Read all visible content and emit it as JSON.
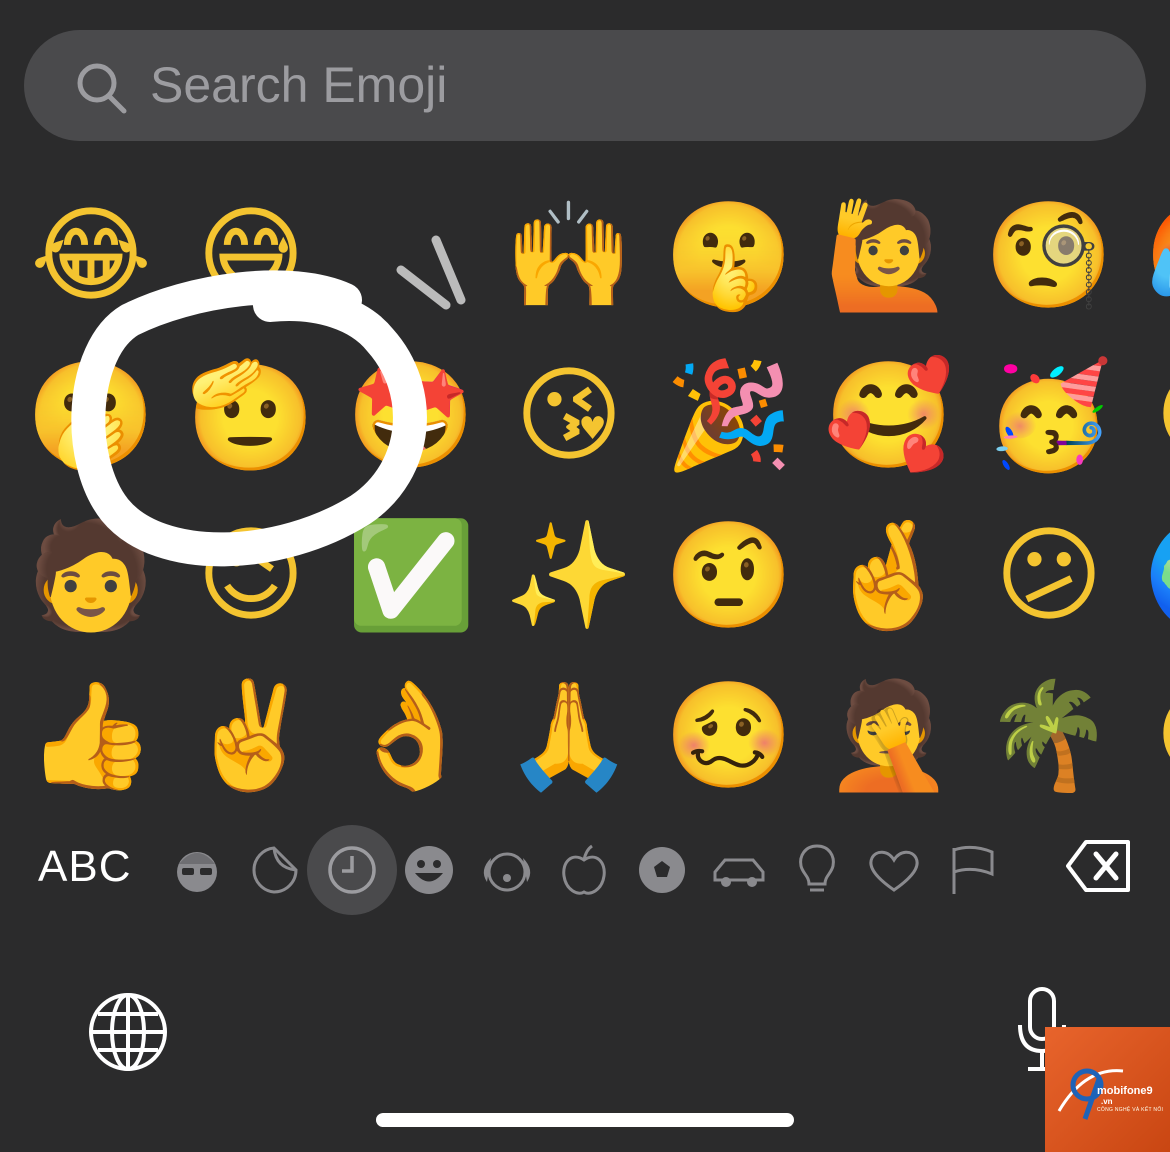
{
  "search": {
    "placeholder": "Search Emoji"
  },
  "emoji_rows": [
    [
      "😂",
      "😅",
      "",
      "🙌",
      "🤫",
      "🙋",
      "🧐",
      "🥵"
    ],
    [
      "🫢",
      "🫡",
      "🤩",
      "😘",
      "🎉",
      "🥰",
      "🥳",
      "😘"
    ],
    [
      "🧑",
      "😉",
      "✅",
      "✨",
      "🤨",
      "🤞",
      "😕",
      "🌍"
    ],
    [
      "👍",
      "✌️",
      "👌",
      "🙏",
      "🥴",
      "🤦",
      "🌴",
      "😀"
    ]
  ],
  "category_bar": {
    "abc_label": "ABC",
    "categories": [
      {
        "icon": "memoji-icon"
      },
      {
        "icon": "sticker-icon"
      },
      {
        "icon": "clock-icon",
        "selected": true
      },
      {
        "icon": "smiley-icon"
      },
      {
        "icon": "dog-icon"
      },
      {
        "icon": "apple-icon"
      },
      {
        "icon": "soccer-ball-icon"
      },
      {
        "icon": "car-icon"
      },
      {
        "icon": "lightbulb-icon"
      },
      {
        "icon": "heart-icon"
      },
      {
        "icon": "flag-icon"
      }
    ],
    "delete_icon": "delete-backspace-icon"
  },
  "bottom_bar": {
    "globe_icon": "globe-icon",
    "mic_icon": "microphone-icon"
  },
  "watermark": {
    "brand": "mobifone9",
    "domain": ".vn",
    "tagline": "CÔNG NGHỆ VÀ KẾT NỐI"
  },
  "colors": {
    "background": "#2b2b2c",
    "search_bg": "#4a4a4c",
    "placeholder": "#9c9ca0",
    "annotation": "#ffffff",
    "watermark": "#e0571f"
  }
}
